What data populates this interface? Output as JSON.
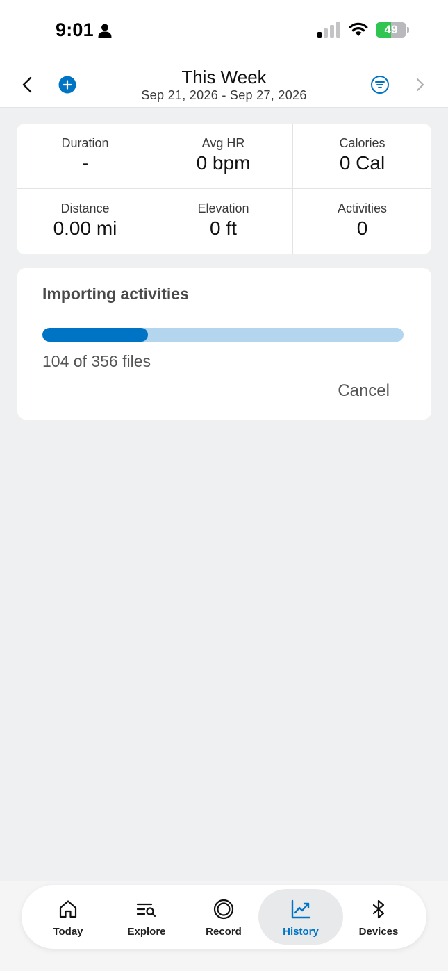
{
  "status_bar": {
    "time": "9:01",
    "battery_level": "49",
    "battery_percent": 49,
    "icons": [
      "person-icon",
      "signal-icon",
      "wifi-icon",
      "battery-charging-icon"
    ]
  },
  "header": {
    "title": "This Week",
    "date_range": "Sep 21, 2026 - Sep 27, 2026",
    "icons": [
      "chevron-left-icon",
      "plus-circle-icon",
      "filter-icon",
      "chevron-right-icon"
    ]
  },
  "stats": [
    {
      "label": "Duration",
      "value": "-"
    },
    {
      "label": "Avg HR",
      "value": "0 bpm"
    },
    {
      "label": "Calories",
      "value": "0 Cal"
    },
    {
      "label": "Distance",
      "value": "0.00 mi"
    },
    {
      "label": "Elevation",
      "value": "0 ft"
    },
    {
      "label": "Activities",
      "value": "0"
    }
  ],
  "import": {
    "title": "Importing activities",
    "progress_text": "104 of 356 files",
    "progress_done": 104,
    "progress_total": 356,
    "cancel_label": "Cancel"
  },
  "nav": {
    "items": [
      {
        "label": "Today",
        "icon": "home-icon"
      },
      {
        "label": "Explore",
        "icon": "explore-icon"
      },
      {
        "label": "Record",
        "icon": "record-icon"
      },
      {
        "label": "History",
        "icon": "trend-chart-icon",
        "active": true
      },
      {
        "label": "Devices",
        "icon": "bluetooth-icon"
      }
    ]
  },
  "colors": {
    "accent": "#0074c4",
    "progress_track": "#b3d6ee",
    "background": "#eff0f2",
    "battery_green": "#2fc550"
  }
}
